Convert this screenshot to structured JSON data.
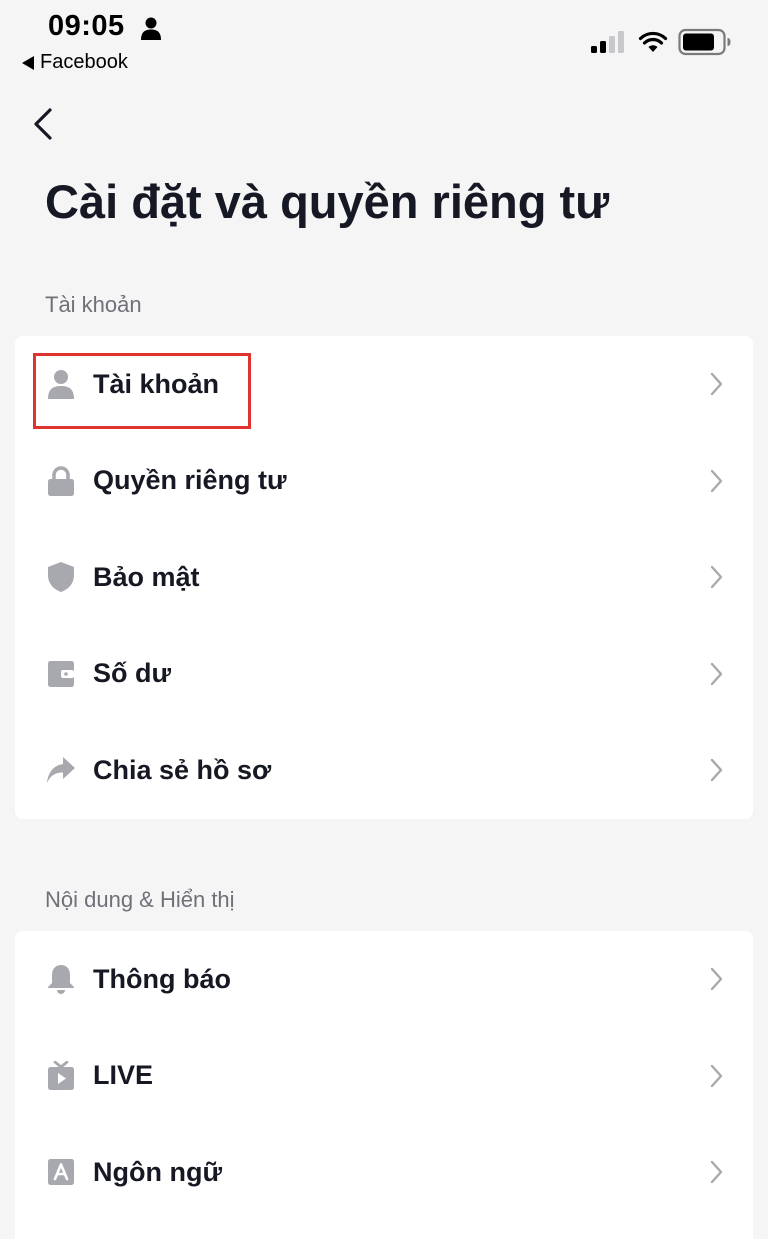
{
  "status_bar": {
    "time": "09:05",
    "back_app_label": "Facebook",
    "icons": [
      "person-icon",
      "signal-icon",
      "wifi-icon",
      "battery-icon"
    ]
  },
  "header": {
    "back_icon": "chevron-left-icon",
    "title": "Cài đặt và quyền riêng tư"
  },
  "sections": [
    {
      "title": "Tài khoản",
      "items": [
        {
          "label": "Tài khoản",
          "icon": "person-icon"
        },
        {
          "label": "Quyền riêng tư",
          "icon": "lock-icon"
        },
        {
          "label": "Bảo mật",
          "icon": "shield-icon"
        },
        {
          "label": "Số dư",
          "icon": "wallet-icon"
        },
        {
          "label": "Chia sẻ hồ sơ",
          "icon": "share-icon"
        }
      ]
    },
    {
      "title": "Nội dung & Hiển thị",
      "items": [
        {
          "label": "Thông báo",
          "icon": "bell-icon"
        },
        {
          "label": "LIVE",
          "icon": "live-tv-icon"
        },
        {
          "label": "Ngôn ngữ",
          "icon": "language-icon"
        }
      ]
    }
  ],
  "colors": {
    "background": "#f5f5f6",
    "card": "#ffffff",
    "text_primary": "#161823",
    "text_secondary": "#6f7078",
    "icon_gray": "#a8a9ae",
    "chevron": "#a8a9ae",
    "highlight": "#e0322f"
  }
}
